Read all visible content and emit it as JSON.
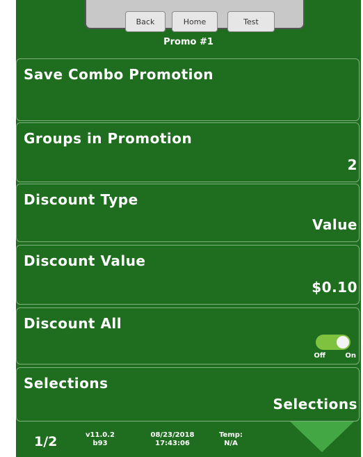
{
  "topbar": {
    "back": "Back",
    "home": "Home",
    "test": "Test"
  },
  "title": "Promo #1",
  "rows": [
    {
      "label": "Save Combo Promotion",
      "value": ""
    },
    {
      "label": "Groups in Promotion",
      "value": "2"
    },
    {
      "label": "Discount Type",
      "value": "Value"
    },
    {
      "label": "Discount Value",
      "value": "$0.10"
    },
    {
      "label": "Discount All",
      "toggle": {
        "off": "Off",
        "on": "On",
        "state": "On"
      }
    },
    {
      "label": "Selections",
      "value": "Selections"
    }
  ],
  "footer": {
    "page": "1/2",
    "version": "v11.0.2",
    "build": "b93",
    "date": "08/23/2018",
    "time": "17:43:06",
    "temp_label": "Temp:",
    "temp_value": "N/A"
  },
  "colors": {
    "background": "#1f6d1f",
    "row_border": "#7fb27f",
    "toggle_on": "#7ec23f",
    "arrow": "#43a843"
  }
}
